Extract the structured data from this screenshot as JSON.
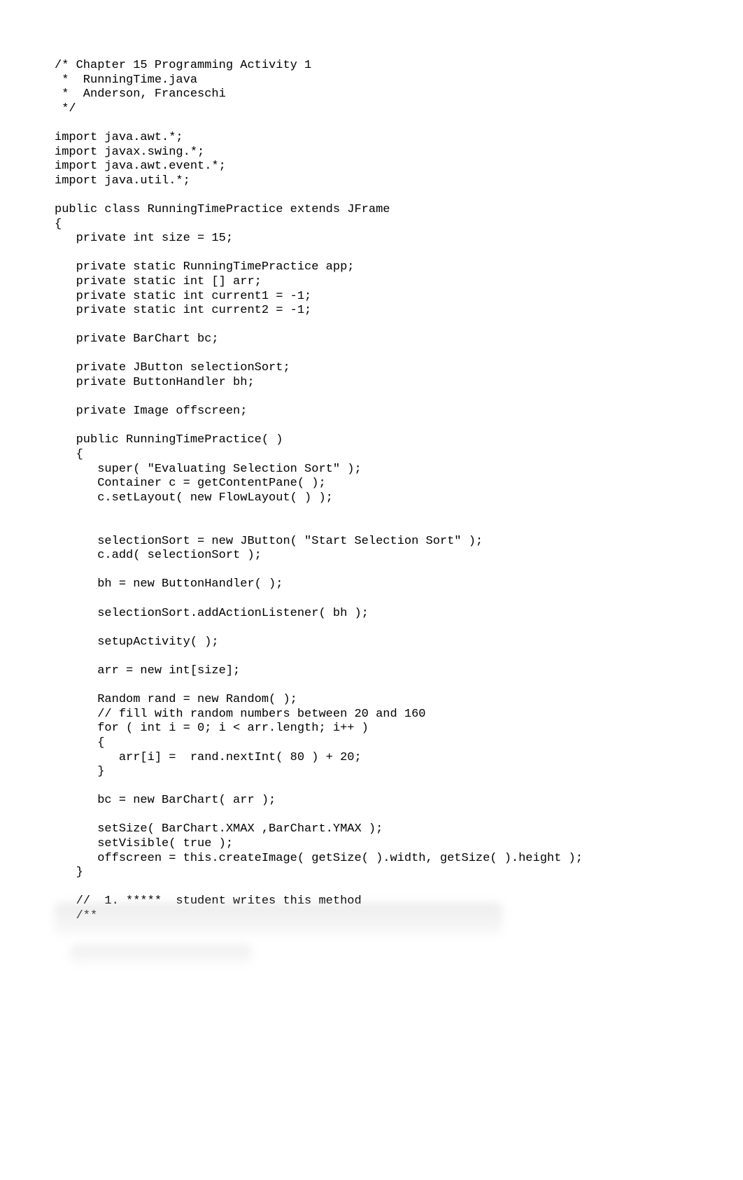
{
  "code_lines": [
    "/* Chapter 15 Programming Activity 1",
    " *  RunningTime.java",
    " *  Anderson, Franceschi",
    " */",
    "",
    "import java.awt.*;",
    "import javax.swing.*;",
    "import java.awt.event.*;",
    "import java.util.*;",
    "",
    "public class RunningTimePractice extends JFrame",
    "{",
    "   private int size = 15;",
    "",
    "   private static RunningTimePractice app;",
    "   private static int [] arr;",
    "   private static int current1 = -1;",
    "   private static int current2 = -1;",
    "",
    "   private BarChart bc;",
    "",
    "   private JButton selectionSort;",
    "   private ButtonHandler bh;",
    "",
    "   private Image offscreen;",
    "",
    "   public RunningTimePractice( )",
    "   {",
    "      super( \"Evaluating Selection Sort\" );",
    "      Container c = getContentPane( );",
    "      c.setLayout( new FlowLayout( ) );",
    "",
    "",
    "      selectionSort = new JButton( \"Start Selection Sort\" );",
    "      c.add( selectionSort );",
    "",
    "      bh = new ButtonHandler( );",
    "",
    "      selectionSort.addActionListener( bh );",
    "",
    "      setupActivity( );",
    "",
    "      arr = new int[size];",
    "",
    "      Random rand = new Random( );",
    "      // fill with random numbers between 20 and 160",
    "      for ( int i = 0; i < arr.length; i++ )",
    "      {",
    "         arr[i] =  rand.nextInt( 80 ) + 20;",
    "      }",
    "",
    "      bc = new BarChart( arr );",
    "",
    "      setSize( BarChart.XMAX ,BarChart.YMAX );",
    "      setVisible( true );",
    "      offscreen = this.createImage( getSize( ).width, getSize( ).height );",
    "   }",
    "",
    "   //  1. *****  student writes this method",
    "   /**"
  ]
}
